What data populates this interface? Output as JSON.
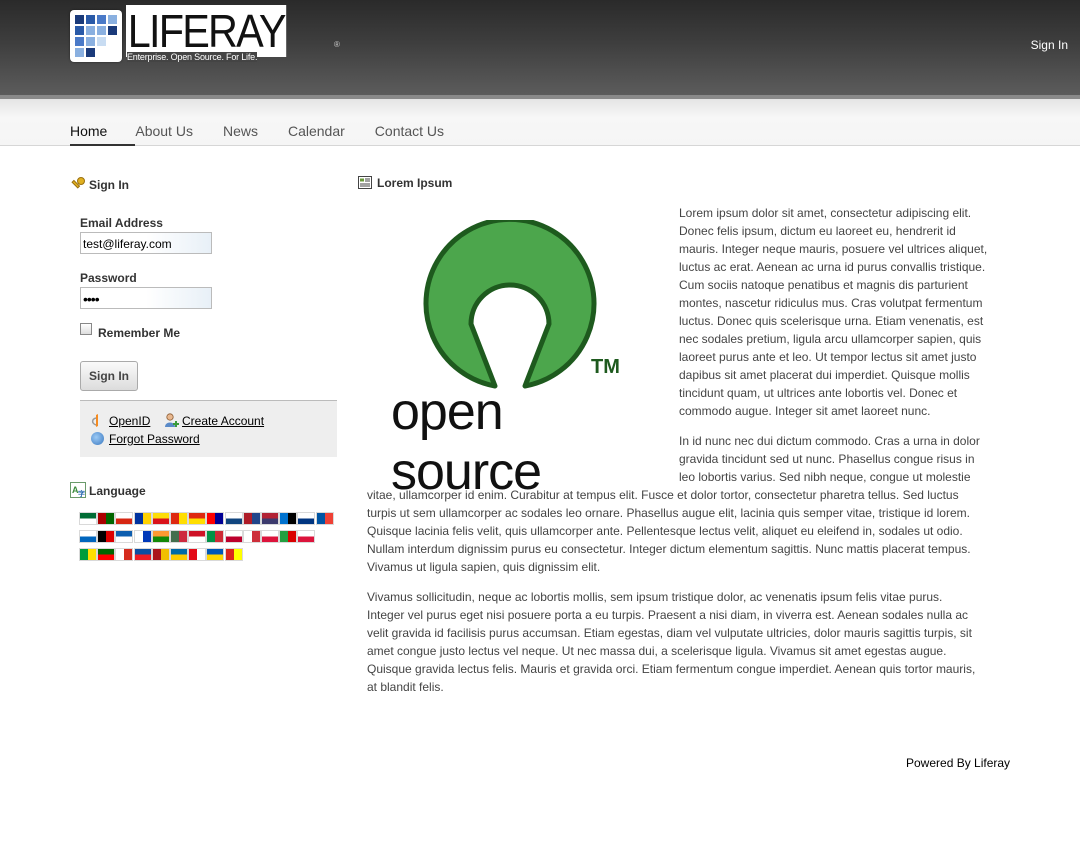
{
  "header": {
    "logo_text": "LIFERAY",
    "logo_tagline": "Enterprise. Open Source. For Life.",
    "logo_reg": "®",
    "sign_in_link": "Sign In"
  },
  "nav": {
    "items": [
      {
        "label": "Home",
        "active": true
      },
      {
        "label": "About Us"
      },
      {
        "label": "News"
      },
      {
        "label": "Calendar"
      },
      {
        "label": "Contact Us"
      }
    ]
  },
  "signin_portlet": {
    "title": "Sign In",
    "email_label": "Email Address",
    "email_value": "test@liferay.com",
    "password_label": "Password",
    "password_value": "••••",
    "remember_label": "Remember Me",
    "submit_label": "Sign In",
    "openid_label": "OpenID",
    "create_account_label": "Create Account",
    "forgot_password_label": "Forgot Password"
  },
  "language_portlet": {
    "title": "Language",
    "flag_count": 36
  },
  "content_portlet": {
    "title": "Lorem Ipsum",
    "image_text": "open source",
    "image_tm": "TM",
    "p1_lines": [
      "Lorem ipsum dolor sit amet, consectetur adipiscing elit.",
      "Donec felis ipsum, dictum eu laoreet eu, hendrerit id",
      "mauris. Integer neque mauris, posuere vel ultrices aliquet,",
      "luctus ac erat. Aenean ac urna id purus convallis tristique.",
      "Cum sociis natoque penatibus et magnis dis parturient",
      "montes, nascetur ridiculus mus. Cras volutpat fermentum",
      "luctus. Donec quis scelerisque urna. Etiam venenatis, est",
      "nec sodales pretium, ligula arcu ullamcorper sapien, quis",
      "laoreet purus ante et leo. Ut tempor lectus sit amet justo",
      "dapibus sit amet placerat dui imperdiet. Quisque mollis",
      "tincidunt quam, ut ultrices ante lobortis vel. Donec et",
      "commodo augue. Integer sit amet laoreet nunc."
    ],
    "p2_lines_narrow": [
      "In id nunc nec dui dictum commodo. Cras a urna in dolor",
      "gravida tincidunt sed ut nunc. Phasellus congue risus in",
      "leo lobortis varius. Sed nibh neque, congue ut molestie"
    ],
    "p2_lines_wide": [
      "vitae, ullamcorper id enim. Curabitur at tempus elit. Fusce et dolor tortor, consectetur pharetra tellus. Sed luctus",
      "turpis ut sem ullamcorper ac sodales leo ornare. Phasellus augue elit, lacinia quis semper vitae, tristique id lorem.",
      "Quisque lacinia felis velit, quis ullamcorper ante. Pellentesque lectus velit, aliquet eu eleifend in, sodales ut odio.",
      "Nullam interdum dignissim purus eu consectetur. Integer dictum elementum sagittis. Nunc mattis placerat tempus.",
      "Vivamus ut ligula sapien, quis dignissim elit."
    ],
    "p3_lines": [
      "Vivamus sollicitudin, neque ac lobortis mollis, sem ipsum tristique dolor, ac venenatis ipsum felis vitae purus.",
      "Integer vel purus eget nisi posuere porta a eu turpis. Praesent a nisi diam, in viverra est. Aenean sodales nulla ac",
      "velit gravida id facilisis purus accumsan. Etiam egestas, diam vel vulputate ultricies, dolor mauris sagittis turpis, sit",
      "amet congue justo lectus vel neque. Ut nec massa dui, a scelerisque ligula. Vivamus sit amet egestas augue.",
      "Quisque gravida lectus felis. Mauris et gravida orci. Etiam fermentum congue imperdiet. Aenean quis tortor mauris,",
      "at blandit felis."
    ]
  },
  "footer": {
    "powered_by": "Powered By Liferay"
  },
  "colors": {
    "header_dark": "#2a2a2a",
    "os_green": "#4ca64c",
    "os_dark_green": "#1e5a1e"
  }
}
